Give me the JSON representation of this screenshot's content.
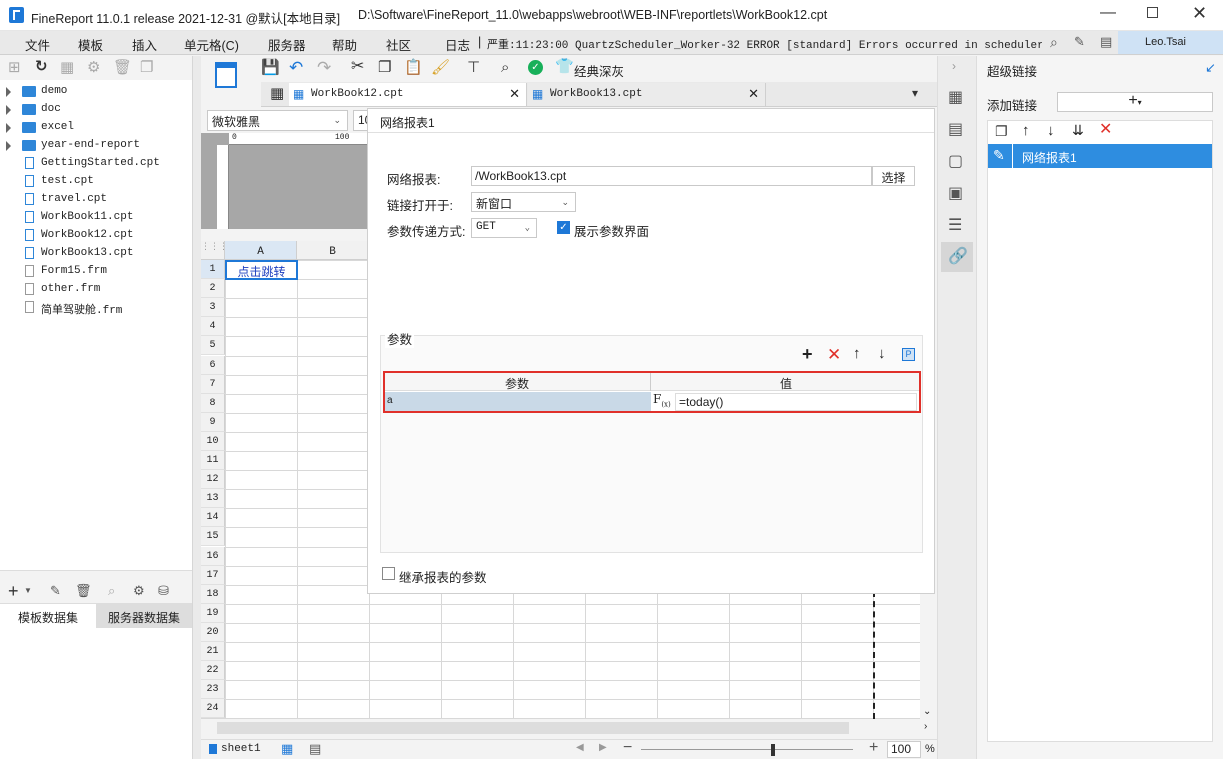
{
  "window": {
    "title": "FineReport 11.0.1 release 2021-12-31 @默认[本地目录]",
    "path": "D:\\Software\\FineReport_11.0\\webapps\\webroot\\WEB-INF\\reportlets\\WorkBook12.cpt"
  },
  "menu": {
    "items": [
      "文件",
      "模板",
      "插入",
      "单元格(C)",
      "服务器",
      "帮助",
      "社区"
    ],
    "log_label": "日志",
    "log_text": "严重:11:23:00 QuartzScheduler_Worker-32 ERROR [standard] Errors occurred in scheduler job ...",
    "user": "Leo.Tsai"
  },
  "toolbar": {
    "theme_label": "经典深灰",
    "font_name": "微软雅黑",
    "font_size": "10"
  },
  "tabs": [
    {
      "label": "WorkBook12.cpt"
    },
    {
      "label": "WorkBook13.cpt"
    }
  ],
  "tree": [
    {
      "label": "demo",
      "type": "folder"
    },
    {
      "label": "doc",
      "type": "folder"
    },
    {
      "label": "excel",
      "type": "folder"
    },
    {
      "label": "year-end-report",
      "type": "folder"
    },
    {
      "label": "GettingStarted.cpt",
      "type": "cpt"
    },
    {
      "label": "test.cpt",
      "type": "cpt"
    },
    {
      "label": "travel.cpt",
      "type": "cpt"
    },
    {
      "label": "WorkBook11.cpt",
      "type": "cpt"
    },
    {
      "label": "WorkBook12.cpt",
      "type": "cpt"
    },
    {
      "label": "WorkBook13.cpt",
      "type": "cpt"
    },
    {
      "label": "Form15.frm",
      "type": "frm"
    },
    {
      "label": "other.frm",
      "type": "frm"
    },
    {
      "label": "简单驾驶舱.frm",
      "type": "frm"
    }
  ],
  "dataset_tabs": {
    "template": "模板数据集",
    "server": "服务器数据集"
  },
  "ruler": {
    "zero": "0",
    "hundred": "100"
  },
  "grid": {
    "columns": [
      "A",
      "B"
    ],
    "rows": [
      "1",
      "2",
      "3",
      "4",
      "5",
      "6",
      "7",
      "8",
      "9",
      "10",
      "11",
      "12",
      "13",
      "14",
      "15",
      "16",
      "17",
      "18",
      "19",
      "20",
      "21",
      "22",
      "23",
      "24"
    ],
    "cell_a1": "点击跳转"
  },
  "dialog": {
    "title": "网络报表1",
    "report_label": "网络报表:",
    "report_value": "/WorkBook13.cpt",
    "choose_btn": "选择",
    "open_label": "链接打开于:",
    "open_value": "新窗口",
    "method_label": "参数传递方式:",
    "method_value": "GET",
    "show_params_label": "展示参数界面",
    "params_section": "参数",
    "table_headers": [
      "参数",
      "值"
    ],
    "param_name": "a",
    "param_value": "=today()",
    "inherit_label": "继承报表的参数"
  },
  "rpanel": {
    "title": "超级链接",
    "add_label": "添加链接",
    "item": "网络报表1"
  },
  "status": {
    "sheet": "sheet1",
    "zoom": "100",
    "percent": "%"
  }
}
